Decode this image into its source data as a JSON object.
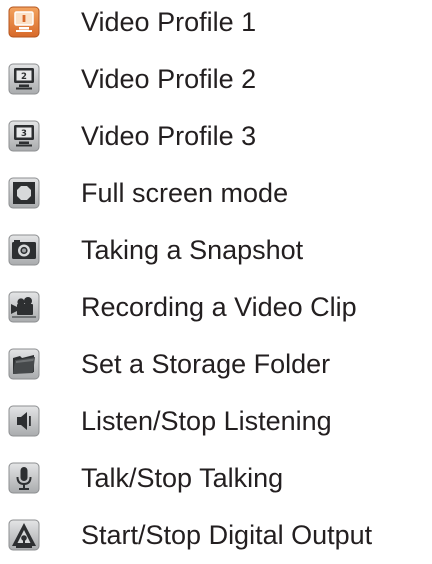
{
  "toolbar_legend": {
    "items": [
      {
        "icon": "video-profile-1-icon",
        "label": "Video Profile 1",
        "active": true
      },
      {
        "icon": "video-profile-2-icon",
        "label": "Video Profile 2"
      },
      {
        "icon": "video-profile-3-icon",
        "label": "Video Profile 3"
      },
      {
        "icon": "full-screen-icon",
        "label": "Full screen mode"
      },
      {
        "icon": "snapshot-camera-icon",
        "label": "Taking a Snapshot"
      },
      {
        "icon": "video-camera-icon",
        "label": "Recording a Video Clip"
      },
      {
        "icon": "folder-icon",
        "label": "Set a Storage Folder"
      },
      {
        "icon": "speaker-icon",
        "label": "Listen/Stop Listening"
      },
      {
        "icon": "microphone-icon",
        "label": "Talk/Stop Talking"
      },
      {
        "icon": "digital-output-icon",
        "label": "Start/Stop Digital Output"
      }
    ]
  },
  "colors": {
    "text": "#231f20",
    "active_icon": "#e07a30",
    "icon_face": "#c9cbcc",
    "icon_dark": "#2d2f31"
  }
}
